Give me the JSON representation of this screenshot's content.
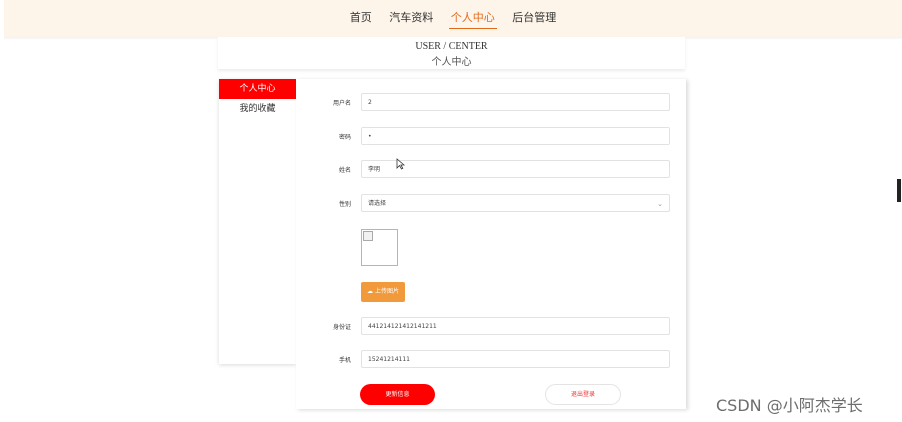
{
  "nav": {
    "items": [
      {
        "label": "首页",
        "active": false
      },
      {
        "label": "汽车资料",
        "active": false
      },
      {
        "label": "个人中心",
        "active": true
      },
      {
        "label": "后台管理",
        "active": false
      }
    ]
  },
  "center_header": {
    "title_en": "USER / CENTER",
    "title_cn": "个人中心"
  },
  "side_menu": {
    "items": [
      {
        "label": "个人中心",
        "active": true
      },
      {
        "label": "我的收藏",
        "active": false
      }
    ]
  },
  "form": {
    "username": {
      "label": "用户名",
      "value": "2"
    },
    "password": {
      "label": "密码",
      "value": "•"
    },
    "name": {
      "label": "姓名",
      "value": "李明"
    },
    "gender": {
      "label": "性别",
      "placeholder": "请选择"
    },
    "upload_label": "上传图片",
    "id_card": {
      "label": "身份证",
      "value": "441214121412141211"
    },
    "phone": {
      "label": "手机",
      "value": "15241214111"
    }
  },
  "buttons": {
    "update": "更新信息",
    "logout": "退出登录"
  },
  "watermark": "CSDN @小阿杰学长",
  "colors": {
    "accent_red": "#ff0000",
    "nav_active": "#e06a1b",
    "upload_orange": "#f09a3c",
    "topbar_bg": "#fdf4ea"
  }
}
